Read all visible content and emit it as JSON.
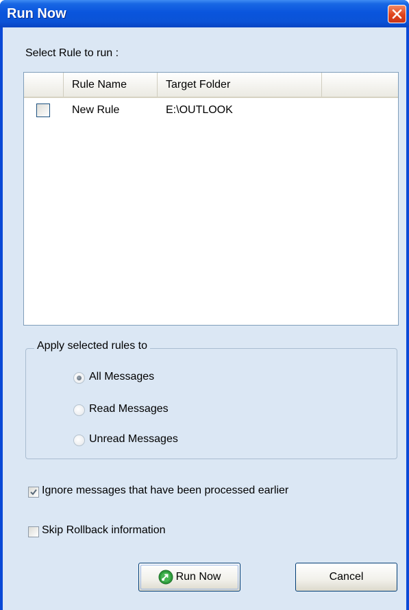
{
  "window": {
    "title": "Run Now",
    "close_icon": "close-icon"
  },
  "select_rule_label": "Select Rule to run :",
  "rule_list": {
    "columns": [
      "",
      "Rule Name",
      "Target Folder",
      ""
    ],
    "rows": [
      {
        "checked": false,
        "rule_name": "New Rule",
        "target_folder": "E:\\OUTLOOK"
      }
    ]
  },
  "apply_group": {
    "title": "Apply selected rules to",
    "options": [
      {
        "label": "All Messages",
        "selected": true
      },
      {
        "label": "Read Messages",
        "selected": false
      },
      {
        "label": "Unread Messages",
        "selected": false
      }
    ],
    "disabled": true
  },
  "ignore_processed": {
    "label": "Ignore messages that have been processed earlier",
    "checked": true
  },
  "skip_rollback": {
    "label": "Skip Rollback information",
    "checked": false
  },
  "buttons": {
    "run_now": "Run Now",
    "cancel": "Cancel",
    "run_icon": "run-icon"
  },
  "colors": {
    "title_bar": "#0a55dd",
    "close_button": "#e0431b",
    "dialog_bg": "#dbe7f4",
    "button_border": "#003c74"
  }
}
